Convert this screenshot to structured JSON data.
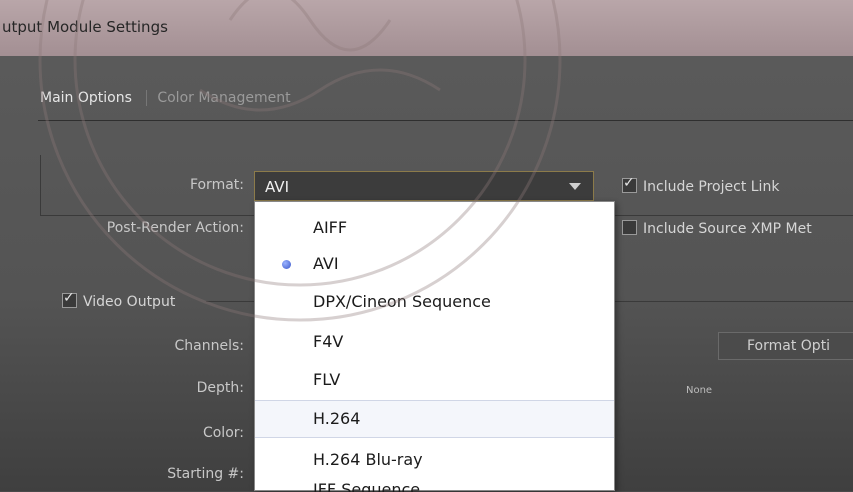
{
  "window": {
    "title": "utput Module Settings"
  },
  "tabs": [
    {
      "label": "Main Options"
    },
    {
      "label": "Color Management"
    }
  ],
  "format": {
    "label": "Format:",
    "value": "AVI"
  },
  "post_render": {
    "label": "Post-Render Action:"
  },
  "checkboxes": {
    "include_project_link": {
      "label": "Include Project Link",
      "checked": true
    },
    "include_source_xmp": {
      "label": "Include Source XMP Met",
      "checked": false
    },
    "video_output": {
      "label": "Video Output",
      "checked": true
    }
  },
  "video_fields": {
    "channels": "Channels:",
    "depth": "Depth:",
    "color": "Color:",
    "starting": "Starting #:"
  },
  "format_options_button": {
    "label": "Format Opti"
  },
  "depth_note": "None",
  "dropdown": {
    "options": [
      {
        "label": "AIFF",
        "selected": false
      },
      {
        "label": "AVI",
        "selected": true
      },
      {
        "label": "DPX/Cineon Sequence",
        "selected": false
      },
      {
        "label": "F4V",
        "selected": false
      },
      {
        "label": "FLV",
        "selected": false
      },
      {
        "label": "H.264",
        "selected": false,
        "hover": true
      },
      {
        "label": "H.264 Blu-ray",
        "selected": false
      },
      {
        "label": "IFF Sequence",
        "selected": false,
        "partial": true
      }
    ]
  },
  "colors": {
    "title_bar": "#b9a6a9",
    "panel": "#545454",
    "dropdown_bg": "#ffffff",
    "accent_border": "#8c7b4a"
  }
}
